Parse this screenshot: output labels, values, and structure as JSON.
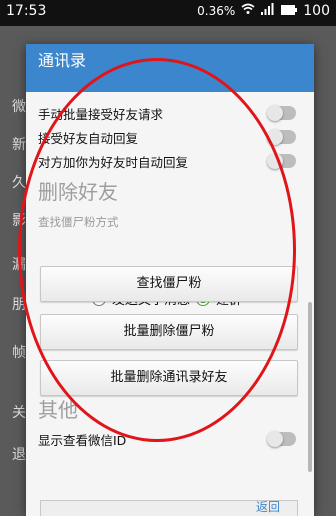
{
  "status": {
    "time": "17:53",
    "speed": "0.36",
    "speed_unit": "%",
    "battery": "100"
  },
  "background": {
    "items": [
      "微",
      "新",
      "久",
      "影",
      "漏",
      "朋",
      "帧",
      "关",
      "退"
    ]
  },
  "dialog": {
    "title": "通讯录",
    "toggles": [
      {
        "label": "手动批量接受好友请求",
        "on": false
      },
      {
        "label": "接受好友自动回复",
        "on": false
      },
      {
        "label": "对方加你为好友时自动回复",
        "on": false
      }
    ],
    "section_delete": "删除好友",
    "find_method_label": "查找僵尸粉方式",
    "radio_options": [
      {
        "label": "发送文字消息",
        "selected": false
      },
      {
        "label": "建群",
        "selected": true
      }
    ],
    "buttons": [
      "查找僵尸粉",
      "批量删除僵尸粉",
      "批量删除通讯录好友"
    ],
    "section_other": "其他",
    "show_wechat_id": {
      "label": "显示查看微信ID",
      "on": false
    },
    "back": "返回"
  },
  "annotation": {
    "color": "#e0151a"
  }
}
